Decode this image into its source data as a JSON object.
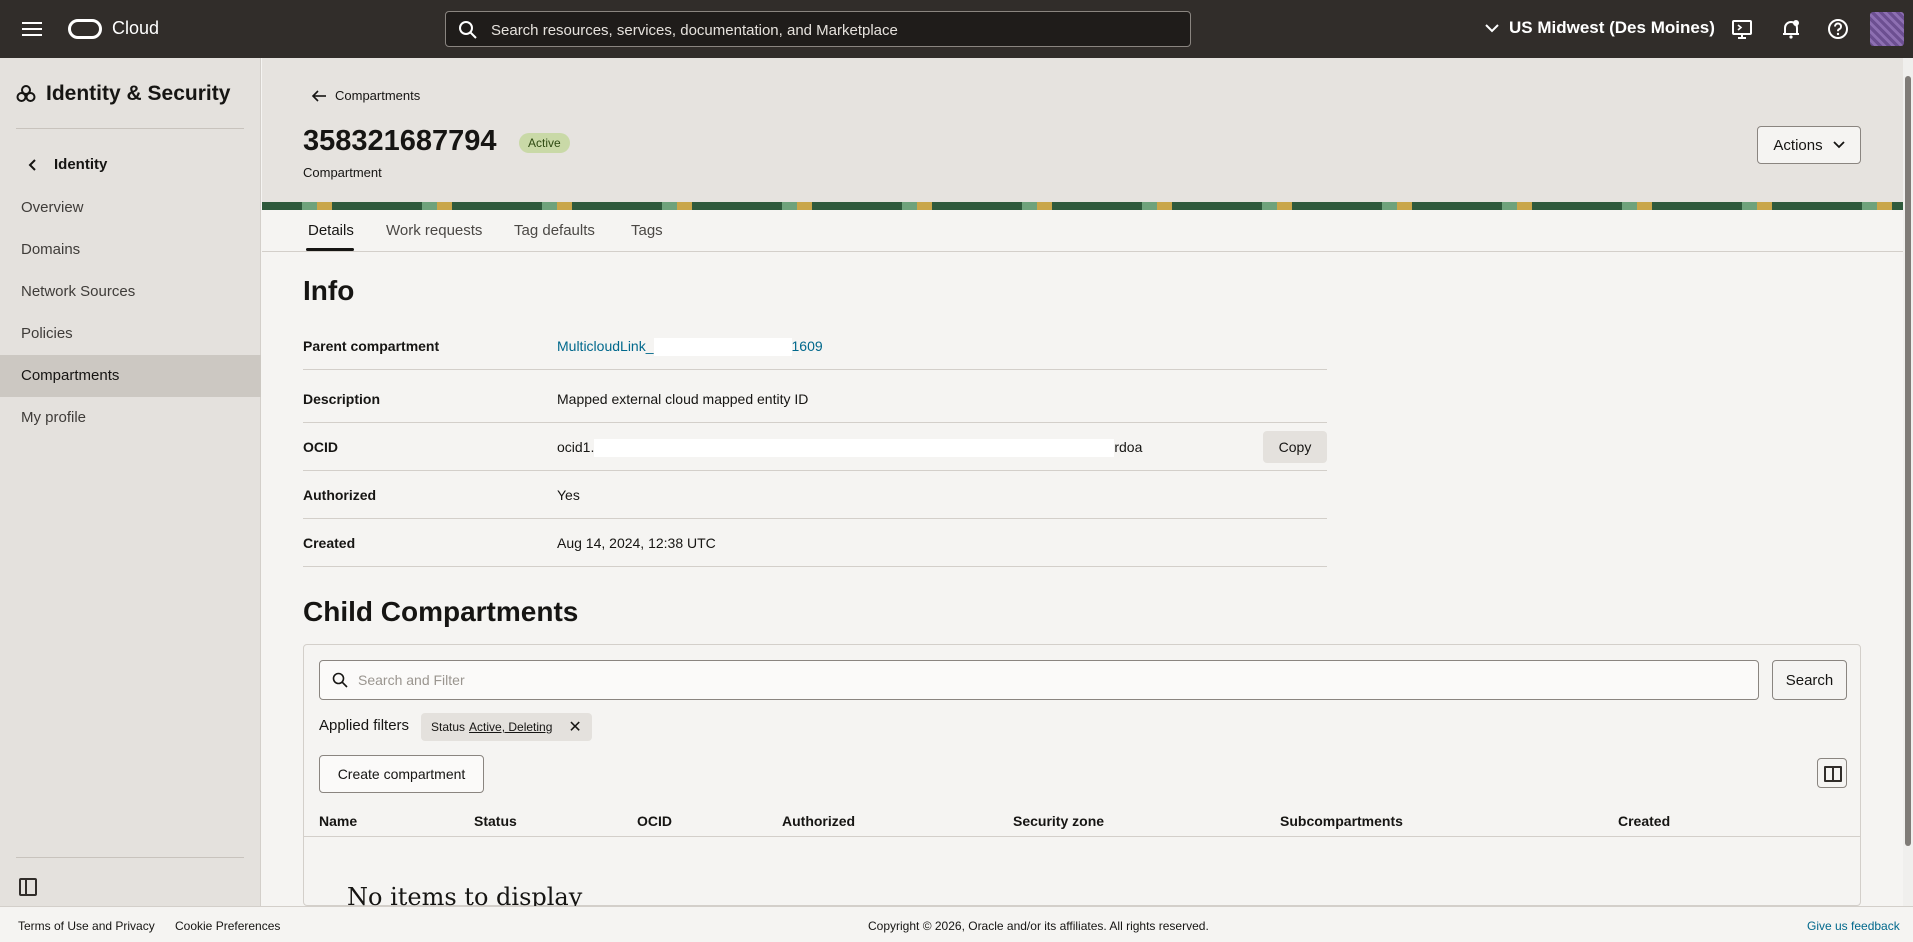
{
  "topbar": {
    "brand": "Cloud",
    "search_placeholder": "Search resources, services, documentation, and Marketplace",
    "region": "US Midwest (Des Moines)"
  },
  "sidebar": {
    "title": "Identity & Security",
    "back_label": "Identity",
    "items": [
      {
        "label": "Overview"
      },
      {
        "label": "Domains"
      },
      {
        "label": "Network Sources"
      },
      {
        "label": "Policies"
      },
      {
        "label": "Compartments",
        "active": true
      },
      {
        "label": "My profile"
      }
    ]
  },
  "header": {
    "breadcrumb": "Compartments",
    "title": "358321687794",
    "status_badge": "Active",
    "subtitle": "Compartment",
    "actions_label": "Actions"
  },
  "tabs": [
    {
      "label": "Details",
      "active": true
    },
    {
      "label": "Work requests"
    },
    {
      "label": "Tag defaults"
    },
    {
      "label": "Tags"
    }
  ],
  "info": {
    "heading": "Info",
    "parent_label": "Parent compartment",
    "parent_prefix": "MulticloudLink_",
    "parent_suffix": "1609",
    "description_label": "Description",
    "description_value": "Mapped external cloud mapped entity ID",
    "ocid_label": "OCID",
    "ocid_prefix": "ocid1.",
    "ocid_suffix": "rdoa",
    "copy_label": "Copy",
    "authorized_label": "Authorized",
    "authorized_value": "Yes",
    "created_label": "Created",
    "created_value": "Aug 14, 2024, 12:38 UTC"
  },
  "child": {
    "heading": "Child Compartments",
    "filter_placeholder": "Search and Filter",
    "search_label": "Search",
    "applied_label": "Applied filters",
    "chip_key": "Status",
    "chip_values": "Active, Deleting",
    "create_label": "Create compartment",
    "columns": [
      "Name",
      "Status",
      "OCID",
      "Authorized",
      "Security zone",
      "Subcompartments",
      "Created"
    ],
    "empty_text": "No items to display"
  },
  "footer": {
    "terms": "Terms of Use and Privacy",
    "cookies": "Cookie Preferences",
    "copyright": "Copyright © 2026, Oracle and/or its affiliates. All rights reserved.",
    "feedback": "Give us feedback"
  }
}
